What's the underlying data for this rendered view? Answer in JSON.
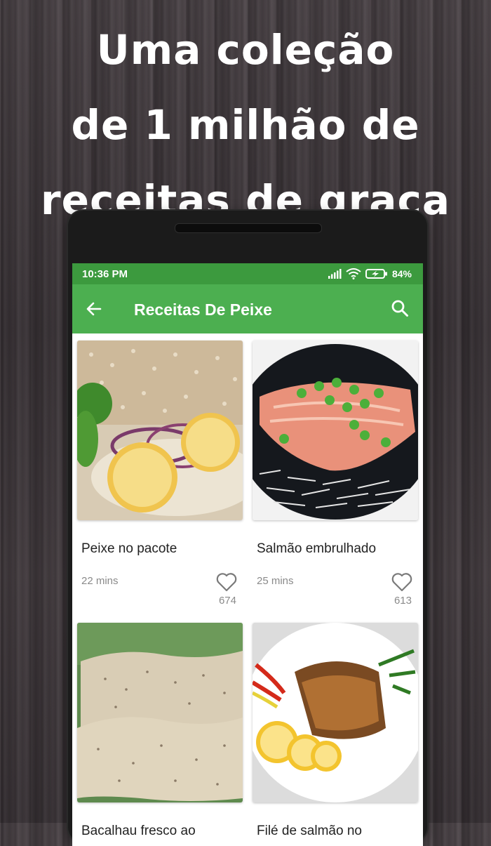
{
  "promo": {
    "line1": "Uma coleção",
    "line2": "de 1 milhão de",
    "line3": "receitas de graça"
  },
  "status_bar": {
    "time": "10:36 PM",
    "battery": "84%",
    "icons": [
      "signal-icon",
      "wifi-icon",
      "battery-charging-icon"
    ]
  },
  "app_bar": {
    "title": "Receitas De Peixe",
    "back_icon": "back-arrow-icon",
    "search_icon": "search-icon"
  },
  "recipes": [
    {
      "title": "Peixe no pacote",
      "time": "22 mins",
      "likes": "674"
    },
    {
      "title": "Salmão embrulhado",
      "time": "25 mins",
      "likes": "613"
    },
    {
      "title": "Bacalhau fresco ao",
      "time": "",
      "likes": ""
    },
    {
      "title": "Filé de salmão no",
      "time": "",
      "likes": ""
    }
  ],
  "colors": {
    "status_bar": "#3c9a3e",
    "app_bar": "#4caf50",
    "meta_text": "#8a8a8a"
  }
}
